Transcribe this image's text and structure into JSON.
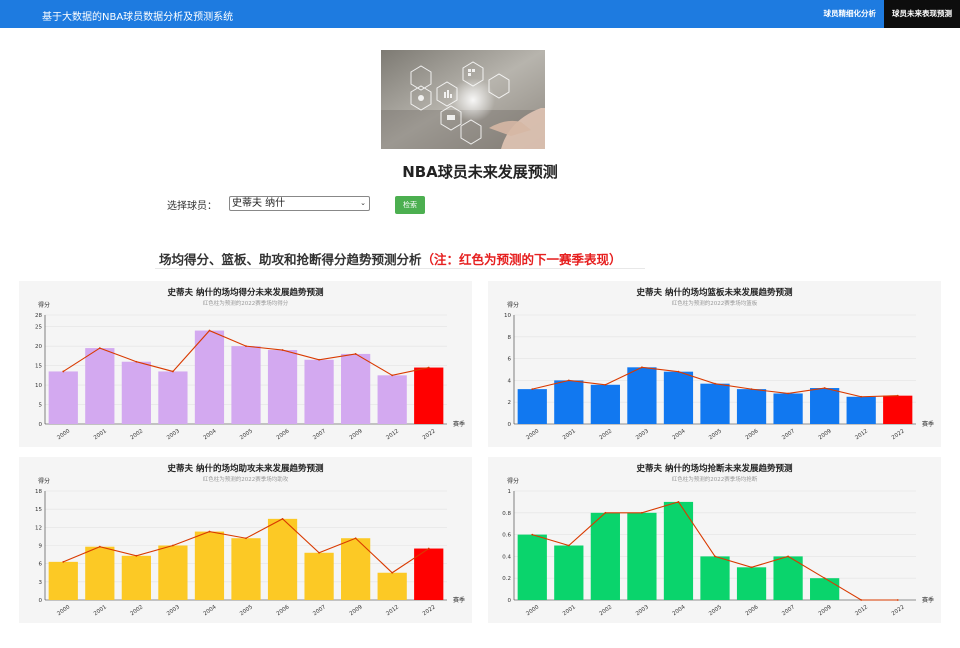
{
  "header": {
    "title": "基于大数据的NBA球员数据分析及预测系统",
    "tabs": [
      {
        "label": "球员精细化分析",
        "active": false
      },
      {
        "label": "球员未来表现预测",
        "active": true
      }
    ]
  },
  "page_title": "NBA球员未来发展预测",
  "selector": {
    "label": "选择球员：",
    "value": "史蒂夫 纳什",
    "button": "检索"
  },
  "section": {
    "title": "场均得分、篮板、助攻和抢断得分趋势预测分析",
    "note": "（注：红色为预测的下一赛季表现）"
  },
  "colors": {
    "nav": "#1e7be0",
    "prediction": "#ff0000",
    "trend_line": "#d93a00",
    "button": "#4caf50"
  },
  "chart_data": [
    {
      "type": "bar",
      "title": "史蒂夫 纳什的场均得分未来发展趋势预测",
      "subtitle": "红色柱为预测的2022赛季场均得分",
      "ylabel": "得分",
      "xlabel": "赛季",
      "ylim": [
        0,
        28
      ],
      "yticks": [
        0,
        5,
        10,
        15,
        20,
        25,
        28
      ],
      "categories": [
        "2000",
        "2001",
        "2002",
        "2003",
        "2004",
        "2005",
        "2006",
        "2007",
        "2009",
        "2012",
        "2022"
      ],
      "values": [
        13.5,
        19.5,
        16,
        13.5,
        24,
        20,
        19,
        16.5,
        18,
        12.5,
        14.5
      ],
      "bar_color": "#d3a9f0",
      "predicted_index": 10
    },
    {
      "type": "bar",
      "title": "史蒂夫 纳什的场均篮板未来发展趋势预测",
      "subtitle": "红色柱为预测的2022赛季场均篮板",
      "ylabel": "得分",
      "xlabel": "赛季",
      "ylim": [
        0,
        10
      ],
      "yticks": [
        0,
        2,
        4,
        6,
        8,
        10
      ],
      "categories": [
        "2000",
        "2001",
        "2002",
        "2003",
        "2004",
        "2005",
        "2006",
        "2007",
        "2009",
        "2012",
        "2022"
      ],
      "values": [
        3.2,
        4.0,
        3.6,
        5.2,
        4.8,
        3.7,
        3.2,
        2.8,
        3.3,
        2.5,
        2.6
      ],
      "bar_color": "#1178f0",
      "predicted_index": 10
    },
    {
      "type": "bar",
      "title": "史蒂夫 纳什的场均助攻未来发展趋势预测",
      "subtitle": "红色柱为预测的2022赛季场均助攻",
      "ylabel": "得分",
      "xlabel": "赛季",
      "ylim": [
        0,
        18
      ],
      "yticks": [
        0,
        3,
        6,
        9,
        12,
        15,
        18
      ],
      "categories": [
        "2000",
        "2001",
        "2002",
        "2003",
        "2004",
        "2005",
        "2006",
        "2007",
        "2009",
        "2012",
        "2022"
      ],
      "values": [
        6.3,
        8.8,
        7.3,
        9,
        11.3,
        10.2,
        13.4,
        7.8,
        10.2,
        4.5,
        8.5
      ],
      "bar_color": "#fcc925",
      "predicted_index": 10
    },
    {
      "type": "bar",
      "title": "史蒂夫 纳什的场均抢断未来发展趋势预测",
      "subtitle": "红色柱为预测的2022赛季场均抢断",
      "ylabel": "得分",
      "xlabel": "赛季",
      "ylim": [
        0,
        1
      ],
      "yticks": [
        0,
        0.2,
        0.4,
        0.6,
        0.8,
        1
      ],
      "categories": [
        "2000",
        "2001",
        "2002",
        "2003",
        "2004",
        "2005",
        "2006",
        "2007",
        "2009",
        "2012",
        "2022"
      ],
      "values": [
        0.6,
        0.5,
        0.8,
        0.8,
        0.9,
        0.4,
        0.3,
        0.4,
        0.2,
        0,
        0
      ],
      "bar_color": "#0ad46c",
      "predicted_index": 10
    }
  ]
}
